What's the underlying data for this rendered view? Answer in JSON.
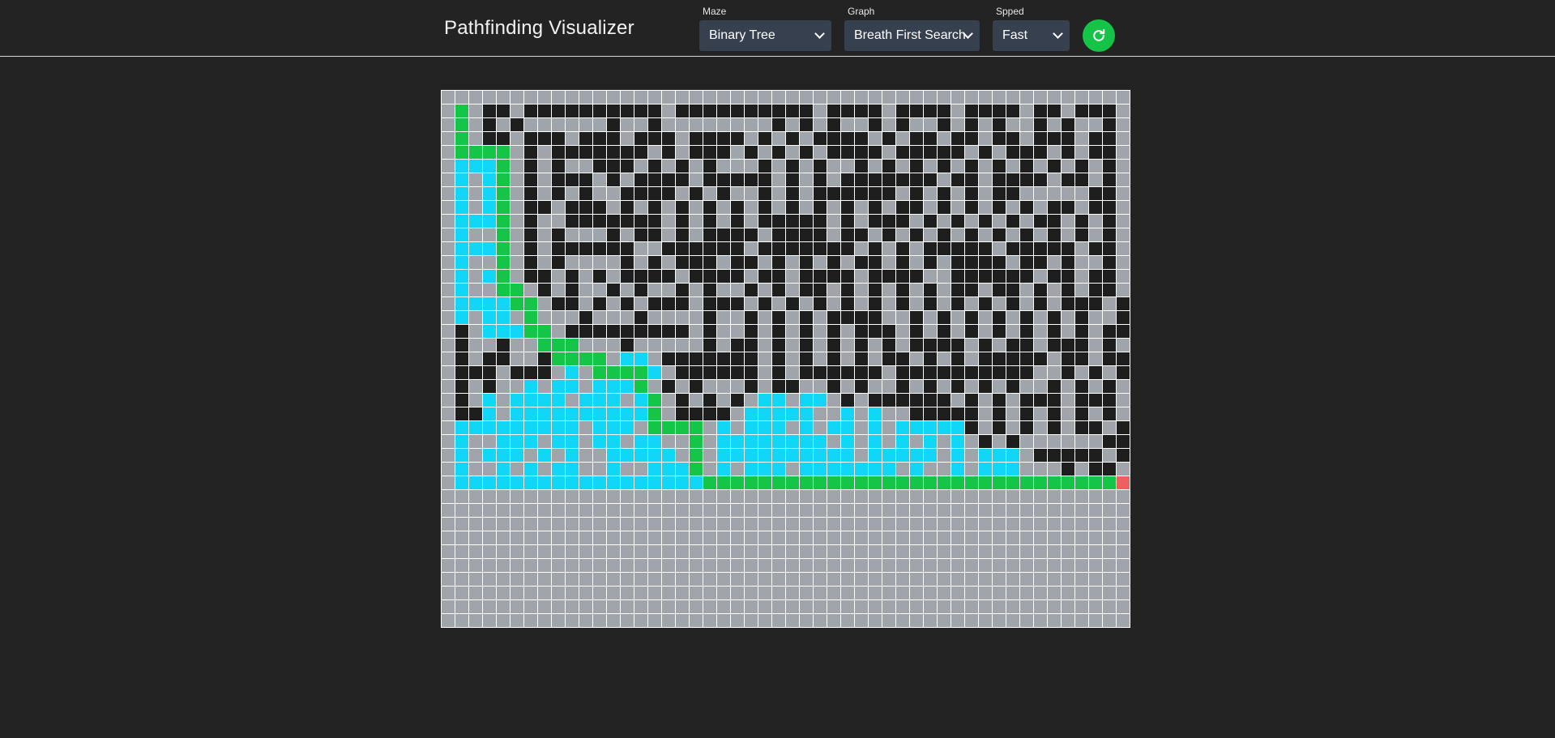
{
  "app": {
    "title": "Pathfinding Visualizer"
  },
  "controls": {
    "maze": {
      "label": "Maze",
      "selected": "Binary Tree"
    },
    "graph": {
      "label": "Graph",
      "selected": "Breath First Search"
    },
    "speed": {
      "label": "Spped",
      "selected": "Fast"
    },
    "refresh_icon": "refresh-icon"
  },
  "colors": {
    "background": "#232323",
    "select_bg": "#36404f",
    "refresh_button": "#15c447",
    "cell_empty": "#a0a4ab",
    "cell_wall": "#1e1e1e",
    "cell_visited": "#12d6f5",
    "cell_path": "#14c547",
    "cell_target": "#ef5f5f",
    "grid_line": "#ffffff"
  },
  "grid": {
    "rows": 39,
    "cols": 50,
    "legend": {
      ".": "empty",
      "#": "wall",
      "v": "visited",
      "p": "path",
      "t": "target"
    },
    "cells": [
      "..................................................",
      ".p.##.##########.##########.####.####.####.##.###.",
      ".p.#.#......#..#........#.#.#..#.#..#.#.#..#.#..#.",
      ".p.##.###.###.###.####.#.#.####.#.##.##.##.###.##.",
      ".pppp.#.#######.#.###.#.#.#.####.#####.#.###.#.##.",
      ".vvvp.#.#..###.#.#.#...#.#.#..#.#.#.#.#.#.#.#.#.#.",
      ".v.vp.#.###.#.####.#####.#.#.#######.##.####.##.#.",
      ".v.vp.#.#.#..####.#.#..#.#.######.#.#.#.##.....##.",
      ".v.vp.##.###.#.#.#.#.#.#.#.#.#.#.##.#.#.#.#.##.##.",
      ".vvvp.#..#######.#.#.#.#####.#.###.#.#.#.#.##.#.#.",
      ".v..p.#.#...#.##.#.####.####.##.#.#.#.#.#.#.#.#.#.",
      ".vvvp.#.######..######.#######.#.#.#####.#####.##.",
      ".v..p.#.#....#.#.###.##.#.#.#.##.#.#.####.##.#..#.",
      ".v.vp.##.#.#.####.####.##.####.####..######.##.##.",
      ".v..pp.#.#..#.#..#.#..#.#.##.#.#.#.#.##.##.#.#.##.",
      ".vvvvpp.##.#.#.###.###.#.#.#.#.#.#.#.#.#.#.#.###.#",
      ".v.vv.p...#...#....#..#.#.#.####..#.#.#.#.#.#.#..#",
      ".#.vvvpp.#########.#..#.#.#.#.###.#.#.#.#.#.#.#.##",
      ".#..#..ppp...#.....#.##.#.#.#.#.#.####.#.##.###.#.",
      ".#.##..#pppp.vv.#######.#.#.#.#.##.#.#.#####.##.##",
      ".###.###.v.ppppv.######.#.######.##########..#.#.#",
      ".#.#..v.vv.vvvp.#.#...#.##..#.#..#.#.#.#.#..#.#.#.",
      ".#.v.vvvv.vvv.vp.#.#.#.vv.vv.#.######.#.#.###.###.",
      ".##v.vvvvvvvvvvp.####.vvvvv..v.v..#####.#.#.#.#.#.",
      ".vvvvvvvvv.vvv.pppp.v.vvv.v.vv.v.vvvvv#.#.#.#.##.#",
      ".v..vvv.vv.vv.vv..p.vvvvvvvv.v.v.v.v.v.#.#......##",
      ".v.vvv.v.v..vvvvv.p.vvvvvvvvvv.vvvvv.v.vvv.#####.#",
      ".v..v.v.vv..v..vvvp.v.vvv.vvvvvvv.v..v.vvv...#.##.",
      ".vvvvvvvvvvvvvvvvvvppppppppppppppppppppppppppppppt",
      ".................................................."
    ]
  }
}
